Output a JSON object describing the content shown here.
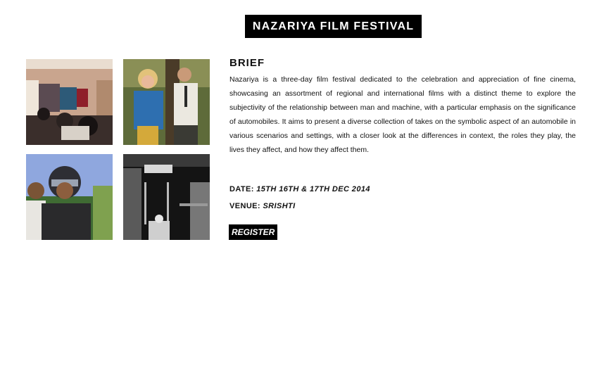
{
  "header": {
    "title": "NAZARIYA FILM FESTIVAL"
  },
  "brief": {
    "heading": "BRIEF",
    "body": "Nazariya is a three-day film festival dedicated to the celebration and appreciation of fine cinema, showcasing an assortment of regional and international films with a distinct theme to explore the subjectivity of the relationship between man and machine, with a particular emphasis on the significance of automobiles. It aims to present a diverse collection of takes on the symbolic aspect of an automobile in various scenarios and settings, with a closer look at the differences in context, the roles they play, the lives they affect, and how they affect them."
  },
  "event": {
    "date_label": "DATE:",
    "date_value": "15TH 16TH & 17TH DEC 2014",
    "venue_label": "VENUE:",
    "venue_value": "SRISHTI"
  },
  "register": {
    "label": "REGISTER"
  },
  "colors": {
    "accent": "#000000",
    "background": "#ffffff"
  }
}
